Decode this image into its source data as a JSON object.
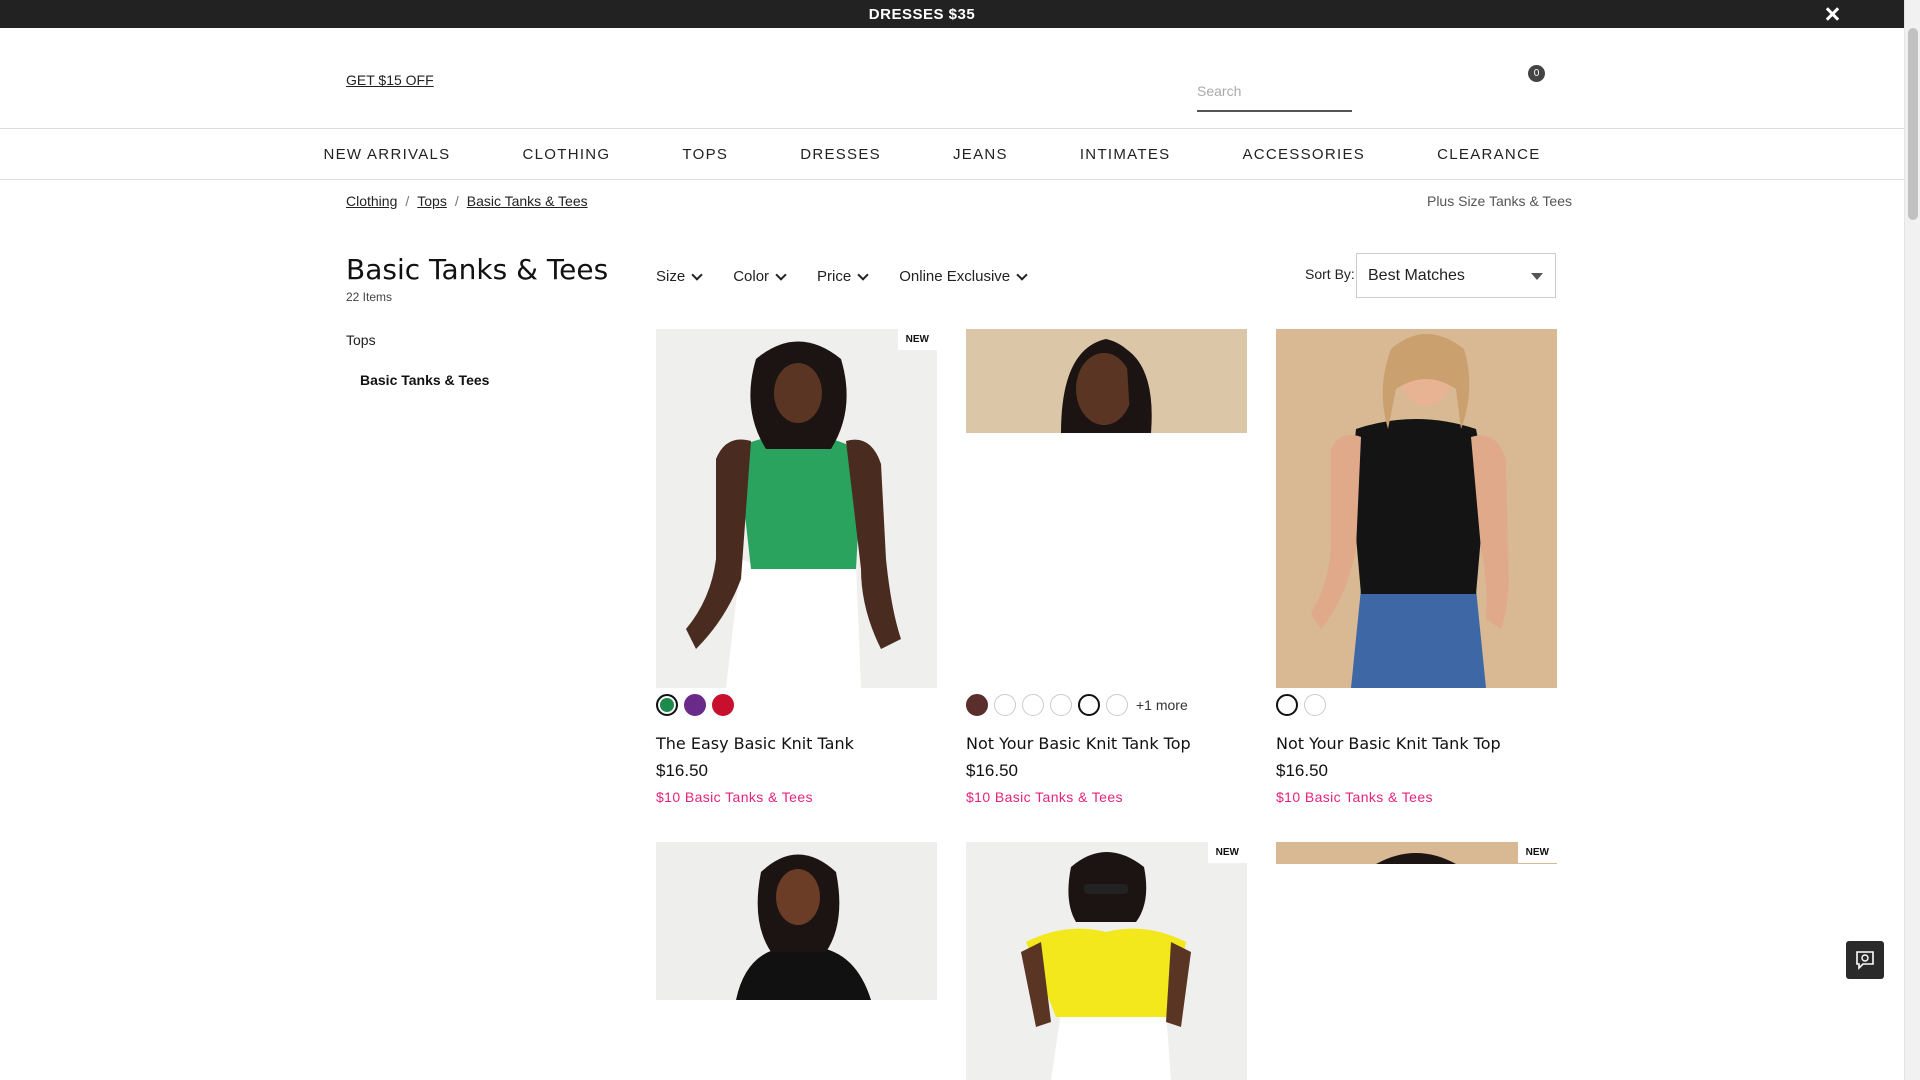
{
  "promo": {
    "text": "DRESSES $35"
  },
  "header": {
    "get_off": "GET $15 OFF",
    "search_placeholder": "Search",
    "cart_count": "0"
  },
  "nav": [
    "NEW ARRIVALS",
    "CLOTHING",
    "TOPS",
    "DRESSES",
    "JEANS",
    "INTIMATES",
    "ACCESSORIES",
    "CLEARANCE"
  ],
  "breadcrumb": [
    "Clothing",
    "Tops",
    "Basic Tanks & Tees"
  ],
  "page_context": "Plus Size Tanks & Tees",
  "page": {
    "title": "Basic Tanks & Tees",
    "count": "22 Items",
    "category_parent": "Tops",
    "category_child": "Basic Tanks & Tees"
  },
  "filters": [
    "Size",
    "Color",
    "Price",
    "Online Exclusive"
  ],
  "sort": {
    "label": "Sort By:",
    "value": "Best Matches"
  },
  "products": [
    {
      "name": "The Easy Basic Knit Tank",
      "price": "$16.50",
      "promo": "$10 Basic Tanks & Tees",
      "badge": "NEW",
      "swatches": [
        "#1b8a4b",
        "#6a2a8a",
        "#c8102e"
      ],
      "more": ""
    },
    {
      "name": "Not Your Basic Knit Tank Top",
      "price": "$16.50",
      "promo": "$10 Basic Tanks & Tees",
      "badge": "",
      "swatches": [
        "#5a2e2a",
        "#ffffff",
        "#ffffff",
        "#ffffff",
        "#ffffff",
        "#ffffff"
      ],
      "more": "+1 more"
    },
    {
      "name": "Not Your Basic Knit Tank Top",
      "price": "$16.50",
      "promo": "$10 Basic Tanks & Tees",
      "badge": "",
      "swatches": [
        "#ffffff",
        "#ffffff"
      ],
      "more": ""
    }
  ],
  "row2_badges": {
    "center": "NEW",
    "right": "NEW"
  }
}
